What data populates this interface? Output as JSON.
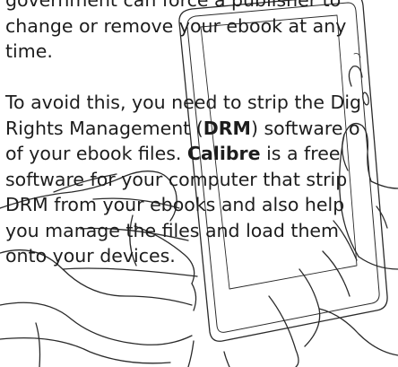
{
  "paragraph1": {
    "line1": "government can force a publisher to",
    "line2": "change or remove your ebook at any",
    "line3": "time."
  },
  "paragraph2": {
    "line1": "To avoid this, you need to strip the Dig",
    "line2_pre": "Rights Management (",
    "line2_bold": "DRM",
    "line2_post": ") software o",
    "line3_pre": "of your ebook files. ",
    "line3_bold": "Calibre",
    "line3_post": " is a free",
    "line4": "software for your computer that strip",
    "line5": "DRM from your ebooks and also help",
    "line6": "you manage the files and load them",
    "line7": "onto your devices."
  },
  "colors": {
    "text": "#1d1d1d",
    "sketch": "#2a2a2a",
    "background": "#ffffff"
  },
  "illustration": {
    "subject": "hands-holding-ebook-reader-sketch"
  }
}
